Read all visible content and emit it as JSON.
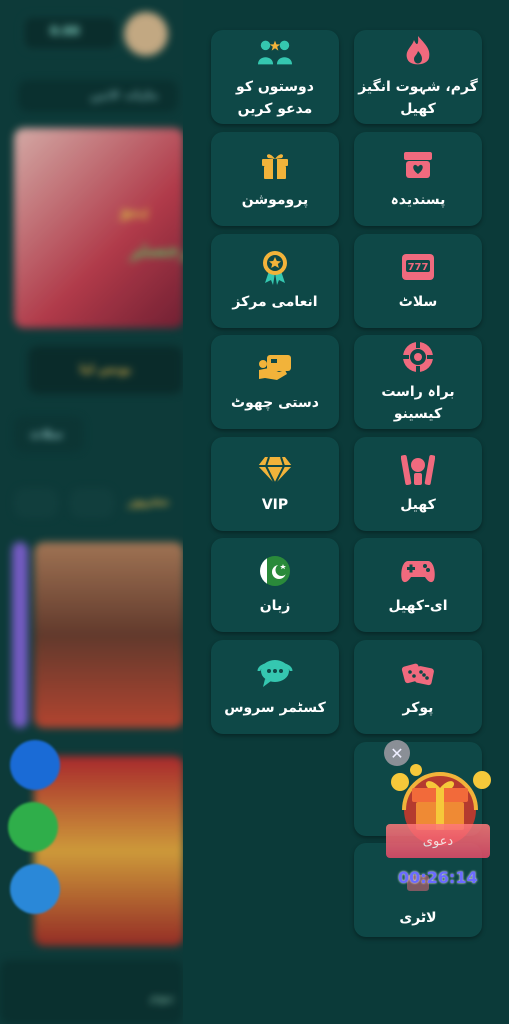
{
  "background": {
    "balance_label": "0.00",
    "vip_label": "ماہانہ لائیں",
    "banner_text_1": "ہیو",
    "banner_text_2": "رجسٹر",
    "promo_bar_label": "بونس لیا",
    "tab_label": "سلاٹ",
    "section_label": "مشہور",
    "nav_home": "ہوم",
    "side_icons": [
      "facebook-icon",
      "whatsapp-icon",
      "user-icon"
    ]
  },
  "menu": {
    "items": [
      {
        "label": "گرم، شہوت انگیز\nکھیل",
        "icon": "flame-icon"
      },
      {
        "label": "دوستوں کو\nمدعو کریں",
        "icon": "invite-friends-icon"
      },
      {
        "label": "پسندیدہ",
        "icon": "favorite-box-icon"
      },
      {
        "label": "پروموشن",
        "icon": "gift-icon"
      },
      {
        "label": "سلاٹ",
        "icon": "slot-machine-icon"
      },
      {
        "label": "انعامی مرکز",
        "icon": "reward-medal-icon"
      },
      {
        "label": "براہ راست\nکیسینو",
        "icon": "casino-chip-icon"
      },
      {
        "label": "دستی چھوٹ",
        "icon": "cashback-icon"
      },
      {
        "label": "کھیل",
        "icon": "sports-icon"
      },
      {
        "label": "VIP",
        "icon": "diamond-icon"
      },
      {
        "label": "ای-کھیل",
        "icon": "gamepad-icon"
      },
      {
        "label": "زبان",
        "icon": "pakistan-flag-icon"
      },
      {
        "label": "پوکر",
        "icon": "dice-icon"
      },
      {
        "label": "کسٹمر سروس",
        "icon": "chat-support-icon"
      },
      {
        "label": "",
        "icon": "hidden-tile-icon"
      },
      {
        "label": "لاٹری",
        "icon": "lottery-icon"
      }
    ]
  },
  "promo_popup": {
    "button_label": "دعوی",
    "timer": "00:26:14",
    "close_icon": "close-icon"
  },
  "colors": {
    "panel_bg": "#0b3a39",
    "tile_bg": "#0e4847",
    "accent_pink": "#f06a7e",
    "accent_gold": "#f2b33a",
    "accent_teal": "#35c7b0"
  }
}
